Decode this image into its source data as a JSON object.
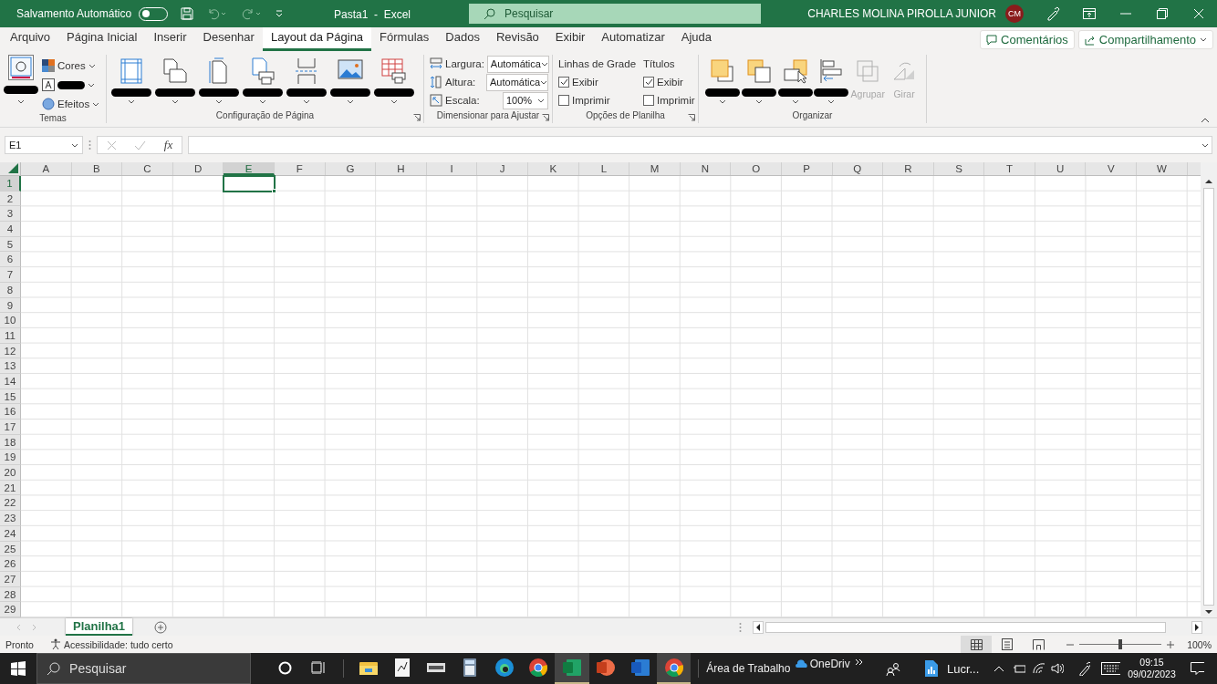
{
  "title_bar": {
    "autosave_label": "Salvamento Automático",
    "autosave_on": false,
    "document_title": "Pasta1  -  Excel",
    "search_placeholder": "Pesquisar",
    "user_name": "CHARLES MOLINA PIROLLA JUNIOR",
    "user_initials": "CM"
  },
  "ribbon_tabs": [
    {
      "label": "Arquivo",
      "selected": false
    },
    {
      "label": "Página Inicial",
      "selected": false
    },
    {
      "label": "Inserir",
      "selected": false
    },
    {
      "label": "Desenhar",
      "selected": false
    },
    {
      "label": "Layout da Página",
      "selected": true
    },
    {
      "label": "Fórmulas",
      "selected": false
    },
    {
      "label": "Dados",
      "selected": false
    },
    {
      "label": "Revisão",
      "selected": false
    },
    {
      "label": "Exibir",
      "selected": false
    },
    {
      "label": "Automatizar",
      "selected": false
    },
    {
      "label": "Ajuda",
      "selected": false
    }
  ],
  "ribbon_actions": {
    "comments": "Comentários",
    "share": "Compartilhamento"
  },
  "themes_group": {
    "label": "Temas",
    "colors": "Cores",
    "effects": "Efeitos"
  },
  "page_setup_group": {
    "label": "Configuração de Página"
  },
  "scale_group": {
    "label": "Dimensionar para Ajustar",
    "rows": [
      {
        "kind": "width",
        "label": "Largura:",
        "value": "Automática"
      },
      {
        "kind": "height",
        "label": "Altura:",
        "value": "Automática"
      },
      {
        "kind": "scale",
        "label": "Escala:",
        "value": "100%"
      }
    ]
  },
  "sheet_options_group": {
    "label": "Opções de Planilha",
    "columns": [
      {
        "title": "Linhas de Grade",
        "view": {
          "label": "Exibir",
          "checked": true
        },
        "print": {
          "label": "Imprimir",
          "checked": false
        }
      },
      {
        "title": "Títulos",
        "view": {
          "label": "Exibir",
          "checked": true
        },
        "print": {
          "label": "Imprimir",
          "checked": false
        }
      }
    ]
  },
  "arrange_group": {
    "label": "Organizar",
    "disabled_buttons": [
      {
        "kind": "group",
        "label": "Agrupar",
        "disabled": true
      },
      {
        "kind": "rotate",
        "label": "Girar",
        "disabled": true
      }
    ]
  },
  "formula_bar": {
    "name_box": "E1",
    "function_label": "fx"
  },
  "columns": [
    {
      "label": "A",
      "selected": false
    },
    {
      "label": "B",
      "selected": false
    },
    {
      "label": "C",
      "selected": false
    },
    {
      "label": "D",
      "selected": false
    },
    {
      "label": "E",
      "selected": true
    },
    {
      "label": "F",
      "selected": false
    },
    {
      "label": "G",
      "selected": false
    },
    {
      "label": "H",
      "selected": false
    },
    {
      "label": "I",
      "selected": false
    },
    {
      "label": "J",
      "selected": false
    },
    {
      "label": "K",
      "selected": false
    },
    {
      "label": "L",
      "selected": false
    },
    {
      "label": "M",
      "selected": false
    },
    {
      "label": "N",
      "selected": false
    },
    {
      "label": "O",
      "selected": false
    },
    {
      "label": "P",
      "selected": false
    },
    {
      "label": "Q",
      "selected": false
    },
    {
      "label": "R",
      "selected": false
    },
    {
      "label": "S",
      "selected": false
    },
    {
      "label": "T",
      "selected": false
    },
    {
      "label": "U",
      "selected": false
    },
    {
      "label": "V",
      "selected": false
    },
    {
      "label": "W",
      "selected": false
    }
  ],
  "rows": [
    {
      "label": "1",
      "selected": true
    },
    {
      "label": "2",
      "selected": false
    },
    {
      "label": "3",
      "selected": false
    },
    {
      "label": "4",
      "selected": false
    },
    {
      "label": "5",
      "selected": false
    },
    {
      "label": "6",
      "selected": false
    },
    {
      "label": "7",
      "selected": false
    },
    {
      "label": "8",
      "selected": false
    },
    {
      "label": "9",
      "selected": false
    },
    {
      "label": "10",
      "selected": false
    },
    {
      "label": "11",
      "selected": false
    },
    {
      "label": "12",
      "selected": false
    },
    {
      "label": "13",
      "selected": false
    },
    {
      "label": "14",
      "selected": false
    },
    {
      "label": "15",
      "selected": false
    },
    {
      "label": "16",
      "selected": false
    },
    {
      "label": "17",
      "selected": false
    },
    {
      "label": "18",
      "selected": false
    },
    {
      "label": "19",
      "selected": false
    },
    {
      "label": "20",
      "selected": false
    },
    {
      "label": "21",
      "selected": false
    },
    {
      "label": "22",
      "selected": false
    },
    {
      "label": "23",
      "selected": false
    },
    {
      "label": "24",
      "selected": false
    },
    {
      "label": "25",
      "selected": false
    },
    {
      "label": "26",
      "selected": false
    },
    {
      "label": "27",
      "selected": false
    },
    {
      "label": "28",
      "selected": false
    },
    {
      "label": "29",
      "selected": false
    }
  ],
  "sheet_tabs": [
    {
      "label": "Planilha1",
      "selected": true
    }
  ],
  "status_bar": {
    "status": "Pronto",
    "accessibility": "Acessibilidade: tudo certo",
    "views": [
      {
        "kind": "normal",
        "selected": true
      },
      {
        "kind": "page_layout",
        "selected": false
      },
      {
        "kind": "page_break",
        "selected": false
      }
    ],
    "zoom": {
      "level": 0.5,
      "reading": "100%"
    }
  },
  "taskbar": {
    "search_placeholder": "Pesquisar",
    "apps": [
      {
        "kind": "explorer",
        "selected": false
      },
      {
        "kind": "ink",
        "selected": false
      },
      {
        "kind": "keyboard",
        "selected": false
      },
      {
        "kind": "calculator",
        "selected": false
      },
      {
        "kind": "edge",
        "selected": false
      },
      {
        "kind": "chrome",
        "selected": false
      },
      {
        "kind": "excel",
        "selected": true
      },
      {
        "kind": "powerpoint",
        "selected": false
      },
      {
        "kind": "word",
        "selected": false
      },
      {
        "kind": "chrome",
        "selected": true
      }
    ],
    "toolbar_label": "Área de Trabalho",
    "onedrive_label": "OneDriv",
    "file_label": "Lucr...",
    "time": "09:15",
    "date": "09/02/2023"
  }
}
